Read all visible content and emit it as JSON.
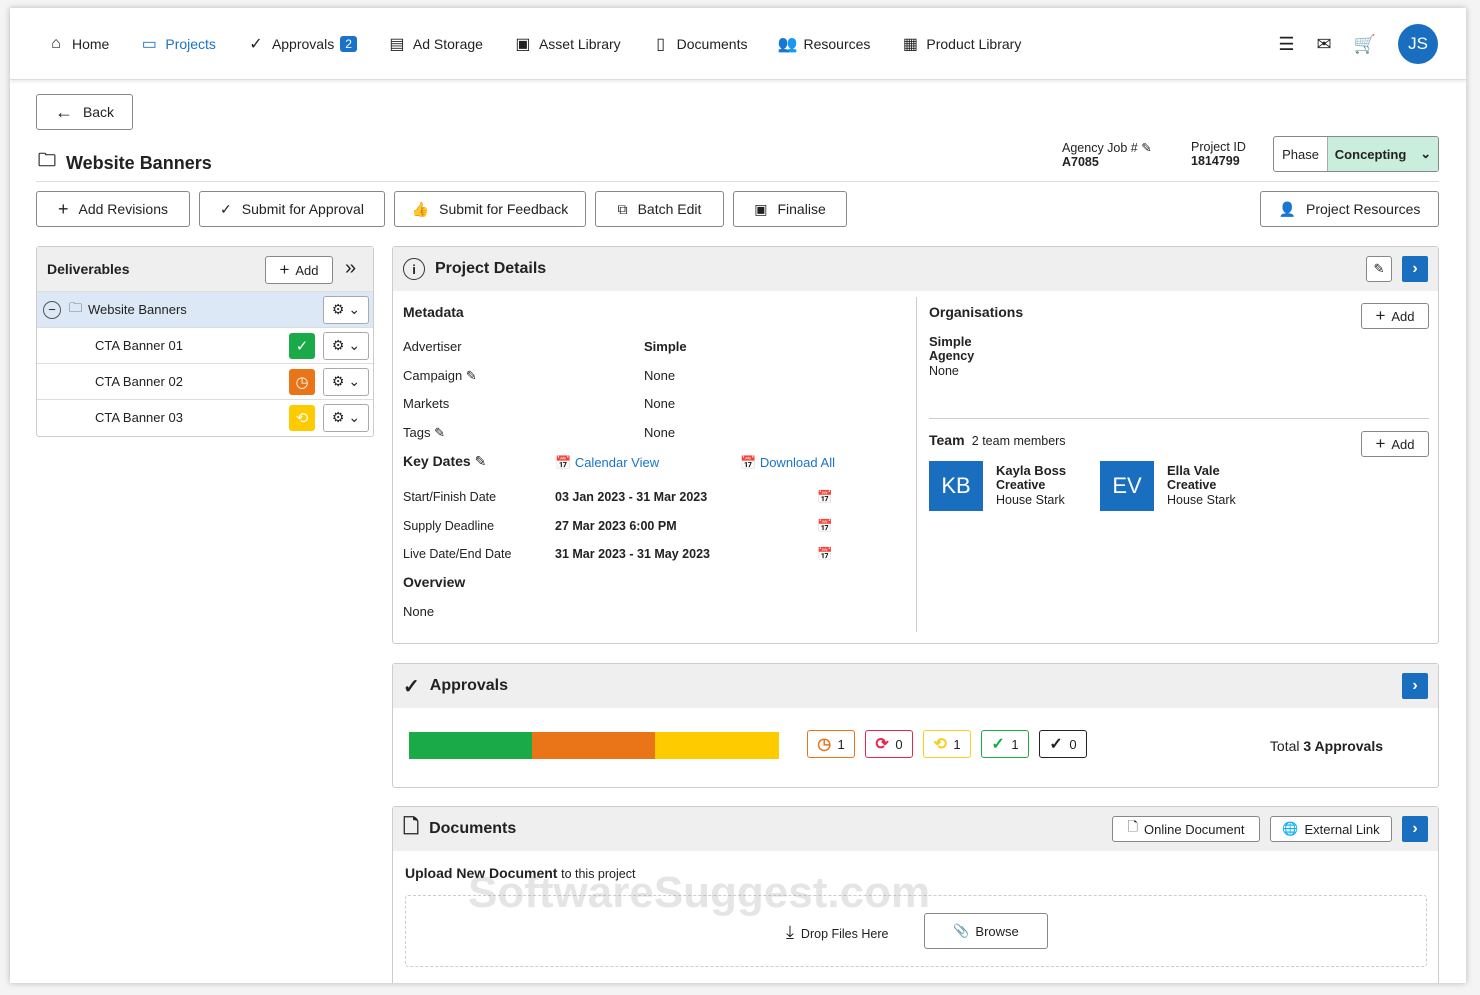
{
  "nav": {
    "items": [
      {
        "label": "Home",
        "icon": "home-icon"
      },
      {
        "label": "Projects",
        "icon": "folder-icon"
      },
      {
        "label": "Approvals",
        "icon": "check-circle-icon",
        "badge": "2"
      },
      {
        "label": "Ad Storage",
        "icon": "storage-icon"
      },
      {
        "label": "Asset Library",
        "icon": "images-icon"
      },
      {
        "label": "Documents",
        "icon": "document-icon"
      },
      {
        "label": "Resources",
        "icon": "people-icon"
      },
      {
        "label": "Product Library",
        "icon": "product-icon"
      }
    ],
    "avatar": "JS"
  },
  "back": "Back",
  "title": "Website Banners",
  "agency_job": {
    "label": "Agency Job #",
    "value": "A7085"
  },
  "project_id": {
    "label": "Project ID",
    "value": "1814799"
  },
  "phase": {
    "label": "Phase",
    "value": "Concepting"
  },
  "toolbar": {
    "add_revisions": "Add Revisions",
    "submit_approval": "Submit for Approval",
    "submit_feedback": "Submit for Feedback",
    "batch_edit": "Batch Edit",
    "finalise": "Finalise",
    "project_resources": "Project Resources"
  },
  "deliverables": {
    "title": "Deliverables",
    "add": "Add",
    "root": "Website Banners",
    "items": [
      {
        "name": "CTA Banner 01",
        "status": "approved"
      },
      {
        "name": "CTA Banner 02",
        "status": "pending"
      },
      {
        "name": "CTA Banner 03",
        "status": "in-progress"
      }
    ]
  },
  "details": {
    "title": "Project Details",
    "metadata_title": "Metadata",
    "metadata": [
      {
        "label": "Advertiser",
        "value": "Simple"
      },
      {
        "label": "Campaign",
        "value": "None"
      },
      {
        "label": "Markets",
        "value": "None"
      },
      {
        "label": "Tags",
        "value": "None"
      }
    ],
    "key_dates_title": "Key Dates",
    "calendar_view": "Calendar View",
    "download_all": "Download All",
    "dates": [
      {
        "label": "Start/Finish Date",
        "value": "03 Jan 2023 - 31 Mar 2023"
      },
      {
        "label": "Supply Deadline",
        "value": "27 Mar 2023 6:00 PM"
      },
      {
        "label": "Live Date/End Date",
        "value": "31 Mar 2023 - 31 May 2023"
      }
    ],
    "overview_title": "Overview",
    "overview": "None",
    "orgs_title": "Organisations",
    "org_add": "Add",
    "org_name": "Simple",
    "org_type": "Agency",
    "org_value": "None",
    "team_title": "Team",
    "team_count": "2 team members",
    "team_add": "Add",
    "team": [
      {
        "initials": "KB",
        "name": "Kayla Boss",
        "role": "Creative",
        "house": "House Stark"
      },
      {
        "initials": "EV",
        "name": "Ella Vale",
        "role": "Creative",
        "house": "House Stark"
      }
    ]
  },
  "approvals": {
    "title": "Approvals",
    "bar": [
      {
        "status": "approved",
        "fraction": 0.333,
        "color": "#1aaa48"
      },
      {
        "status": "pending",
        "fraction": 0.333,
        "color": "#ea7418"
      },
      {
        "status": "in-progress",
        "fraction": 0.334,
        "color": "#fdcb00"
      }
    ],
    "chips": [
      {
        "status": "pending",
        "count": "1",
        "color": "#ea7418",
        "glyph": "◷"
      },
      {
        "status": "changes",
        "count": "0",
        "color": "#e8254a",
        "glyph": "⟳"
      },
      {
        "status": "in-progress",
        "count": "1",
        "color": "#f5cf1a",
        "glyph": "⟲"
      },
      {
        "status": "approved",
        "count": "1",
        "color": "#1aaa48",
        "glyph": "✓"
      },
      {
        "status": "final",
        "count": "0",
        "color": "#222222",
        "glyph": "✓"
      }
    ],
    "total_prefix": "Total",
    "total": "3 Approvals"
  },
  "documents": {
    "title": "Documents",
    "online": "Online Document",
    "external": "External Link",
    "upload_bold": "Upload New Document",
    "upload_rest": "to this project",
    "drop": "Drop Files Here",
    "browse": "Browse"
  },
  "watermark": "SoftwareSuggest.com"
}
